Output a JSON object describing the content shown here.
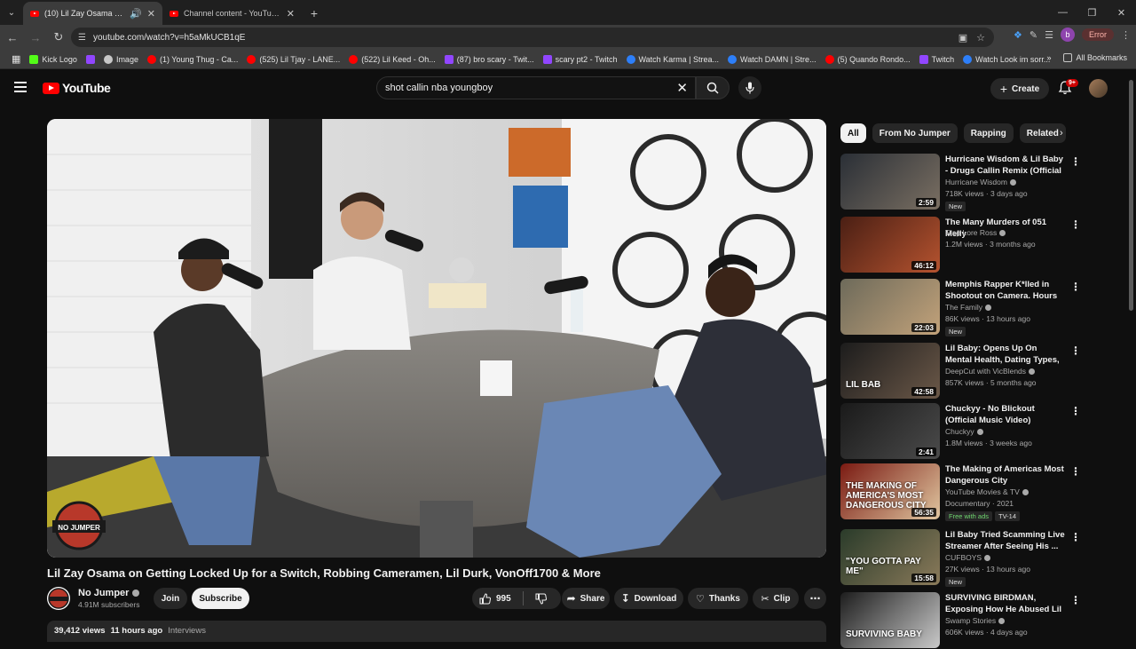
{
  "browser": {
    "tabs": [
      {
        "title": "(10) Lil Zay Osama on Gettin",
        "active": true
      },
      {
        "title": "Channel content - YouTube Stu",
        "active": false
      }
    ],
    "url": "youtube.com/watch?v=h5aMkUCB1qE",
    "profile_letter": "b",
    "error_label": "Error",
    "bookmarks": [
      {
        "label": "Kick Logo",
        "color": "#53fc18"
      },
      {
        "label": "",
        "color": "#9146ff"
      },
      {
        "label": "Image",
        "color": "#c7c7c7"
      },
      {
        "label": "(1) Young Thug - Ca...",
        "color": "#ff0000"
      },
      {
        "label": "(525) Lil Tjay - LANE...",
        "color": "#ff0000"
      },
      {
        "label": "(522) Lil Keed - Oh...",
        "color": "#ff0000"
      },
      {
        "label": "(87) bro scary - Twit...",
        "color": "#9146ff"
      },
      {
        "label": "scary pt2 - Twitch",
        "color": "#9146ff"
      },
      {
        "label": "Watch Karma | Strea...",
        "color": "#2d7ff9"
      },
      {
        "label": "Watch DAMN | Stre...",
        "color": "#2d7ff9"
      },
      {
        "label": "(5) Quando Rondo...",
        "color": "#ff0000"
      },
      {
        "label": "Twitch",
        "color": "#9146ff"
      },
      {
        "label": "Watch Look im sorr...",
        "color": "#2d7ff9"
      }
    ],
    "all_bookmarks": "All Bookmarks"
  },
  "youtube": {
    "logo": "YouTube",
    "search_query": "shot callin nba youngboy",
    "create_label": "Create",
    "notif_count": "9+"
  },
  "video": {
    "title": "Lil Zay Osama on Getting Locked Up for a Switch, Robbing Cameramen, Lil Durk, VonOff1700 & More",
    "watermark": "NO JUMPER",
    "channel": "No Jumper",
    "subscribers": "4.91M subscribers",
    "join_label": "Join",
    "subscribe_label": "Subscribe",
    "likes": "995",
    "share_label": "Share",
    "download_label": "Download",
    "thanks_label": "Thanks",
    "clip_label": "Clip",
    "views": "39,412 views",
    "age": "11 hours ago",
    "tag": "Interviews"
  },
  "sidebar": {
    "chips": [
      "All",
      "From No Jumper",
      "Rapping",
      "Related"
    ],
    "recommendations": [
      {
        "title": "Hurricane Wisdom & Lil Baby - Drugs Callin Remix (Official ...",
        "channel": "Hurricane Wisdom",
        "meta": "718K views · 3 days ago",
        "duration": "2:59",
        "badge": "New",
        "thumb": [
          "#2a2f36",
          "#7a6f62"
        ]
      },
      {
        "title": "The Many Murders of 051 Melly",
        "channel": "Trap Lore Ross",
        "meta": "1.2M views · 3 months ago",
        "duration": "46:12",
        "badge": "",
        "thumb": [
          "#4a1f14",
          "#b5532f"
        ]
      },
      {
        "title": "Memphis Rapper K*lled in Shootout on Camera. Hours ...",
        "channel": "The Family",
        "meta": "86K views · 13 hours ago",
        "duration": "22:03",
        "badge": "New",
        "thumb": [
          "#6d6a5a",
          "#c2a27a"
        ]
      },
      {
        "title": "Lil Baby: Opens Up On Mental Health, Dating Types, Lists To...",
        "channel": "DeepCut with VicBlends",
        "meta": "857K views · 5 months ago",
        "duration": "42:58",
        "badge": "",
        "thumb": [
          "#1c1c1c",
          "#6b5848"
        ],
        "thumb_text": "LIL BAB"
      },
      {
        "title": "Chuckyy - No Blickout (Official Music Video)",
        "channel": "Chuckyy",
        "meta": "1.8M views · 3 weeks ago",
        "duration": "2:41",
        "badge": "",
        "thumb": [
          "#1a1a1a",
          "#4b4b4b"
        ]
      },
      {
        "title": "The Making of Americas Most Dangerous City",
        "channel": "YouTube Movies & TV",
        "meta": "Documentary · 2021",
        "duration": "56:35",
        "badge": "Free with ads",
        "badge2": "TV-14",
        "thumb": [
          "#7a1a12",
          "#e0c6a0"
        ],
        "thumb_text": "THE MAKING OF AMERICA'S MOST DANGEROUS CITY"
      },
      {
        "title": "Lil Baby Tried Scamming Live Streamer After Seeing His ...",
        "channel": "CUFBOYS",
        "meta": "27K views · 13 hours ago",
        "duration": "15:58",
        "badge": "New",
        "thumb": [
          "#2a3b2a",
          "#8a7a5a"
        ],
        "thumb_text": "\"YOU GOTTA PAY ME\""
      },
      {
        "title": "SURVIVING BIRDMAN, Exposing How He Abused Lil Wayne, Tri...",
        "channel": "Swamp Stories",
        "meta": "606K views · 4 days ago",
        "duration": "",
        "badge": "",
        "thumb": [
          "#1d1d1d",
          "#c9c9c9"
        ],
        "thumb_text": "SURVIVING BABY"
      }
    ]
  }
}
